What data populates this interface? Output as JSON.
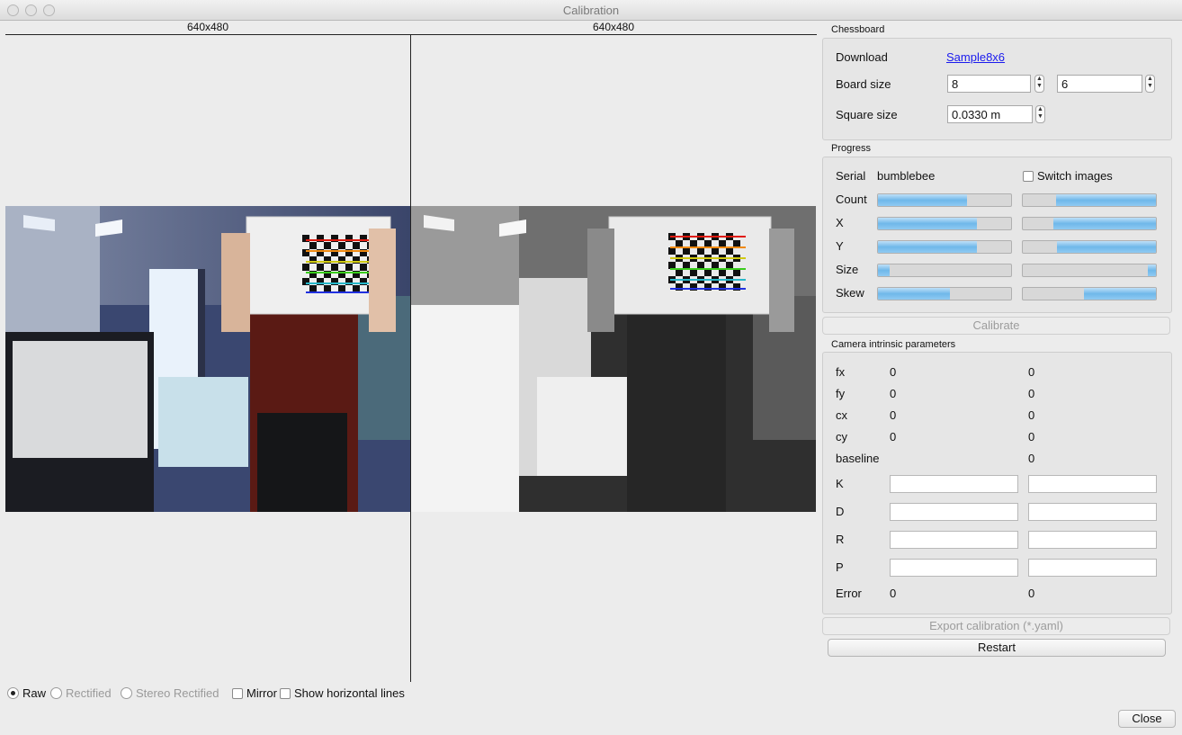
{
  "window": {
    "title": "Calibration"
  },
  "views": {
    "left_label": "640x480",
    "right_label": "640x480"
  },
  "view_options": {
    "raw": "Raw",
    "rectified": "Rectified",
    "stereo_rectified": "Stereo Rectified",
    "mirror": "Mirror",
    "show_horizontal_lines": "Show horizontal lines",
    "selected": "Raw"
  },
  "chessboard": {
    "title": "Chessboard",
    "download_label": "Download",
    "download_link": "Sample8x6",
    "board_size_label": "Board size",
    "board_size_w": "8",
    "board_size_h": "6",
    "square_size_label": "Square size",
    "square_size": "0.0330 m"
  },
  "progress": {
    "title": "Progress",
    "serial_label": "Serial",
    "serial_value": "bumblebee",
    "switch_images": "Switch images",
    "rows": [
      {
        "label": "Count",
        "left": 0.67,
        "right_start": 0.25,
        "right_end": 1.0
      },
      {
        "label": "X",
        "left": 0.74,
        "right_start": 0.23,
        "right_end": 1.0
      },
      {
        "label": "Y",
        "left": 0.74,
        "right_start": 0.26,
        "right_end": 1.0
      },
      {
        "label": "Size",
        "left": 0.09,
        "right_start": 0.94,
        "right_end": 1.0
      },
      {
        "label": "Skew",
        "left": 0.54,
        "right_start": 0.46,
        "right_end": 1.0
      }
    ]
  },
  "calibrate_button": "Calibrate",
  "intrinsics": {
    "title": "Camera intrinsic parameters",
    "scalars": [
      {
        "label": "fx",
        "left": "0",
        "right": "0"
      },
      {
        "label": "fy",
        "left": "0",
        "right": "0"
      },
      {
        "label": "cx",
        "left": "0",
        "right": "0"
      },
      {
        "label": "cy",
        "left": "0",
        "right": "0"
      },
      {
        "label": "baseline",
        "left": "",
        "right": "0"
      }
    ],
    "matrices": [
      {
        "label": "K",
        "left": "",
        "right": ""
      },
      {
        "label": "D",
        "left": "",
        "right": ""
      },
      {
        "label": "R",
        "left": "",
        "right": ""
      },
      {
        "label": "P",
        "left": "",
        "right": ""
      }
    ],
    "error_label": "Error",
    "error_left": "0",
    "error_right": "0"
  },
  "export_button": "Export calibration (*.yaml)",
  "restart_button": "Restart",
  "close_button": "Close"
}
